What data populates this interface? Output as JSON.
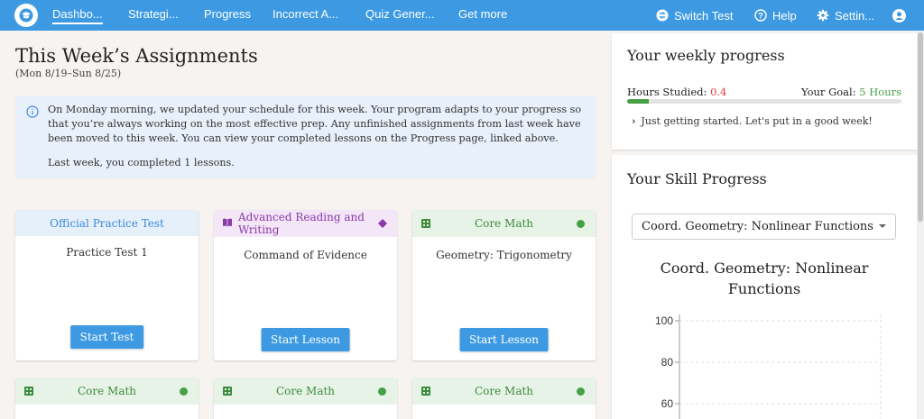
{
  "nav": {
    "items": [
      "Dashbo...",
      "Strategi...",
      "Progress",
      "Incorrect A...",
      "Quiz Gener...",
      "Get more"
    ],
    "switch_test": "Switch Test",
    "help": "Help",
    "settings": "Settin...",
    "brand_color": "#3d9ae2"
  },
  "main": {
    "title": "This Week’s Assignments",
    "date_range": "(Mon 8/19–Sun 8/25)",
    "notice": {
      "text": "On Monday morning, we updated your schedule for this week. Your program adapts to your progress so that you’re always working on the most effective prep. Any unfinished assignments from last week have been moved to this week. You can view your completed lessons on the Progress page, linked above.",
      "last_week": "Last week, you completed 1 lessons."
    },
    "cards": [
      {
        "category": "Official Practice Test",
        "title": "Practice Test 1",
        "button": "Start Test"
      },
      {
        "category": "Advanced Reading and Writing",
        "title": "Command of Evidence",
        "button": "Start Lesson"
      },
      {
        "category": "Core Math",
        "title": "Geometry: Trigonometry",
        "button": "Start Lesson"
      },
      {
        "category": "Core Math"
      },
      {
        "category": "Core Math"
      },
      {
        "category": "Core Math"
      }
    ]
  },
  "weekly": {
    "title": "Your weekly progress",
    "hours_label": "Hours Studied:",
    "hours_value": "0.4",
    "goal_label": "Your Goal:",
    "goal_value": "5 Hours",
    "progress_fraction": 0.08,
    "message": "Just getting started. Let's put in a good week!"
  },
  "skill": {
    "title": "Your Skill Progress",
    "selected": "Coord. Geometry: Nonlinear Functions",
    "chart_title": "Coord. Geometry: Nonlinear Functions"
  },
  "chart_data": {
    "type": "line",
    "title": "Coord. Geometry: Nonlinear Functions",
    "yticks": [
      100,
      80,
      60
    ],
    "ylim": [
      0,
      100
    ],
    "series": [],
    "grid": true
  }
}
